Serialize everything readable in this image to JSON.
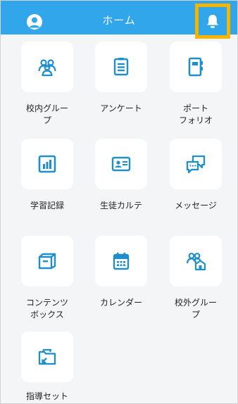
{
  "header": {
    "title": "ホーム"
  },
  "items": [
    {
      "line1": "校内グルー",
      "line2": "プ"
    },
    {
      "line1": "アンケート",
      "line2": ""
    },
    {
      "line1": "ポート",
      "line2": "フォリオ"
    },
    {
      "line1": "学習記録",
      "line2": ""
    },
    {
      "line1": "生徒カルテ",
      "line2": ""
    },
    {
      "line1": "メッセージ",
      "line2": ""
    },
    {
      "line1": "コンテンツ",
      "line2": "ボックス"
    },
    {
      "line1": "カレンダー",
      "line2": ""
    },
    {
      "line1": "校外グルー",
      "line2": "プ"
    },
    {
      "line1": "指導セット",
      "line2": ""
    }
  ],
  "icons": {
    "profile": "user-avatar-icon",
    "notifications": "bell-icon",
    "items": [
      "group-icon",
      "survey-clipboard-icon",
      "portfolio-binder-icon",
      "bar-chart-icon",
      "id-card-icon",
      "chat-bubbles-icon",
      "content-box-icon",
      "calendar-icon",
      "external-group-icon",
      "guidance-folder-icon"
    ]
  },
  "colors": {
    "header": "#32a6ea",
    "icon": "#1e8fcb",
    "highlight": "#f7b500"
  }
}
